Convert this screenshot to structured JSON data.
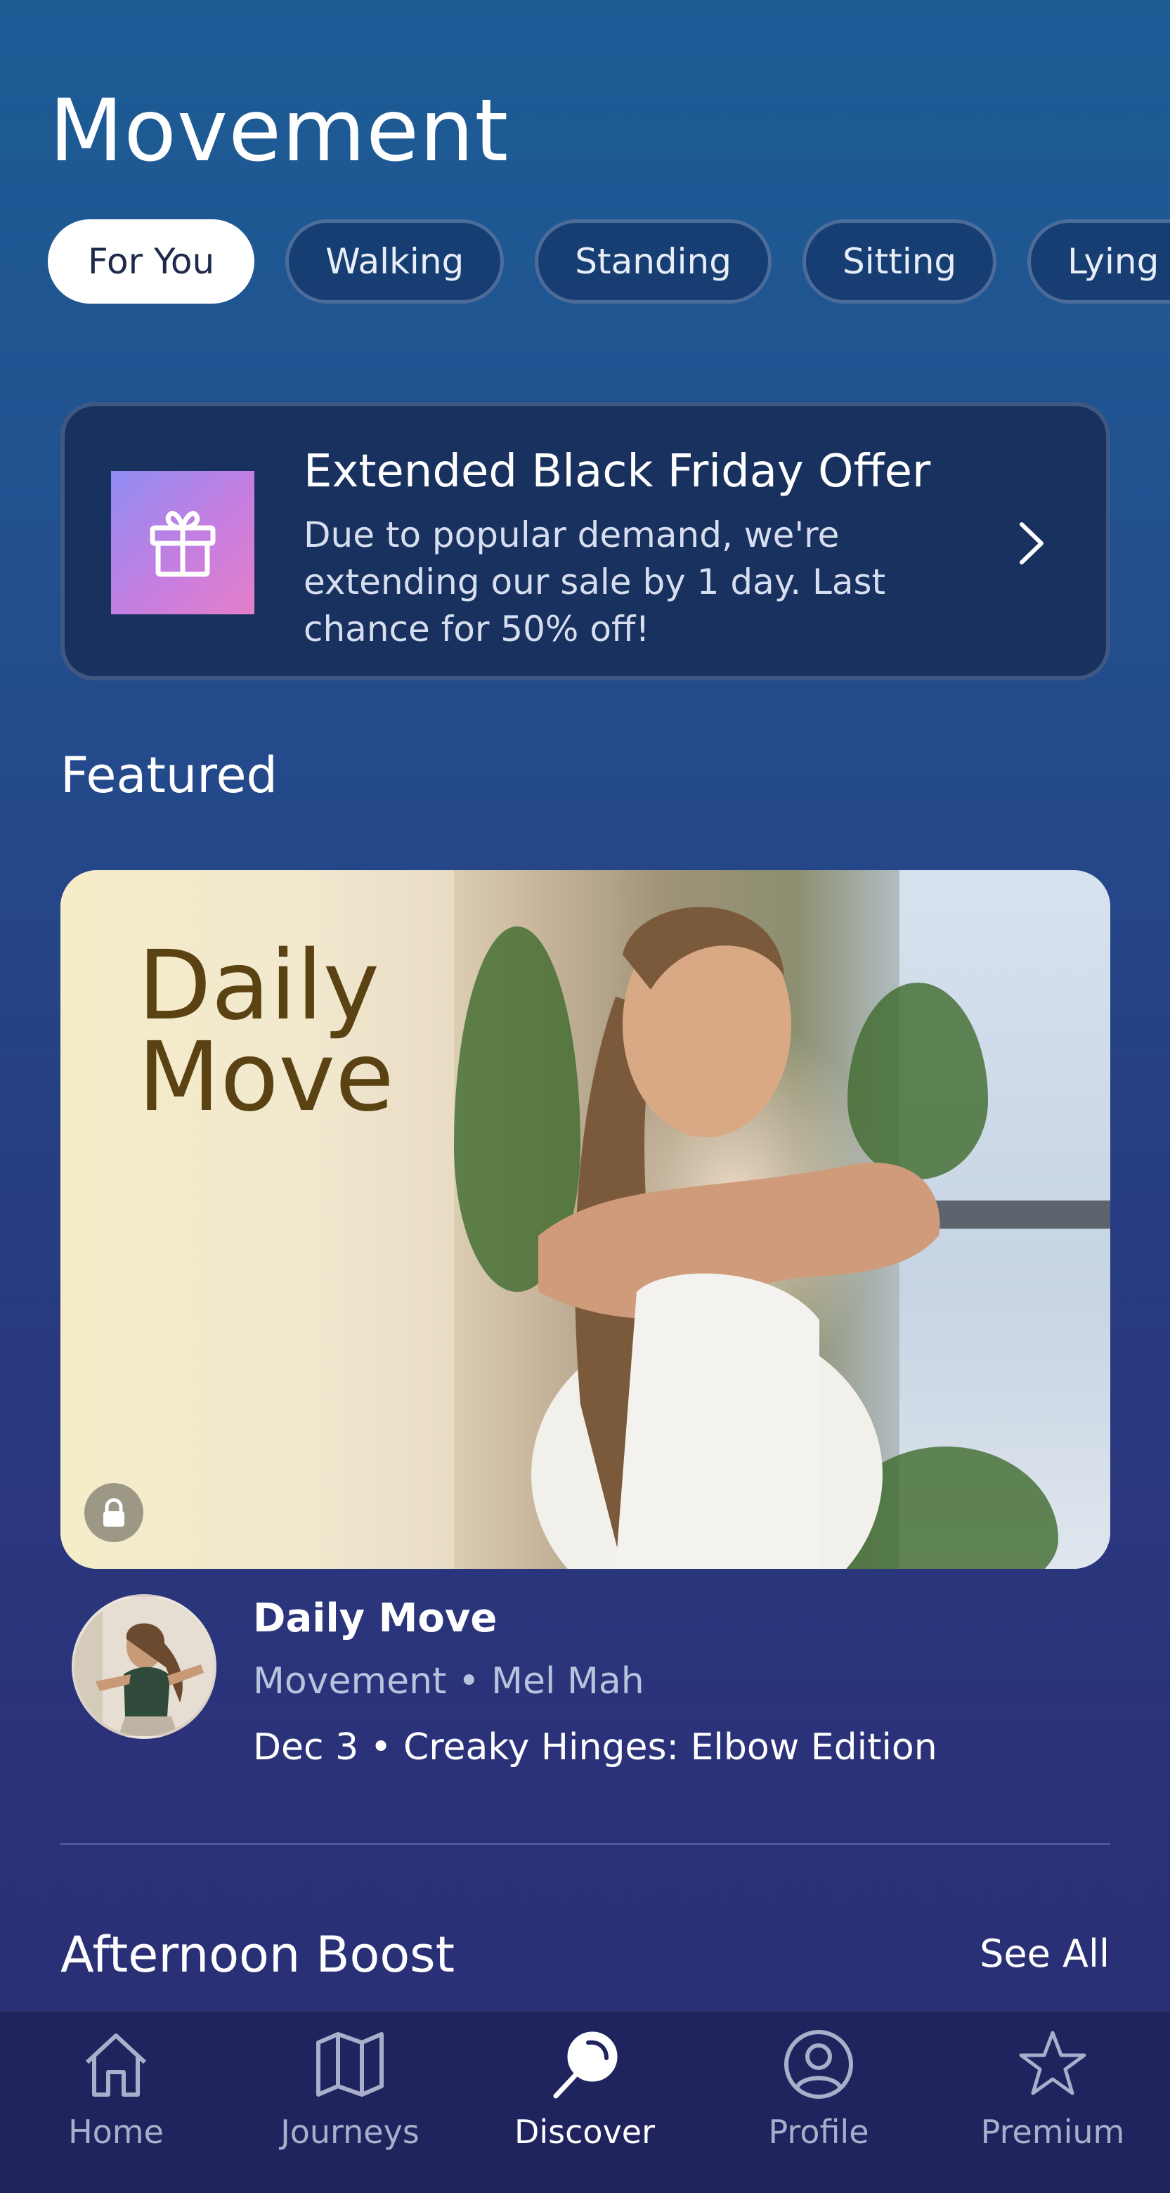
{
  "header": {
    "title": "Movement"
  },
  "filters": [
    {
      "label": "For You",
      "active": true
    },
    {
      "label": "Walking",
      "active": false
    },
    {
      "label": "Standing",
      "active": false
    },
    {
      "label": "Sitting",
      "active": false
    },
    {
      "label": "Lying D",
      "active": false
    }
  ],
  "offer": {
    "title": "Extended Black Friday Offer",
    "body": "Due to popular demand, we're extending our sale by 1 day. Last chance for 50% off!",
    "icon": "gift-icon"
  },
  "featured": {
    "section_title": "Featured",
    "card_overlay_text_line1": "Daily",
    "card_overlay_text_line2": "Move",
    "locked": true,
    "title": "Daily Move",
    "subtitle": "Movement • Mel Mah",
    "date_line": "Dec 3 • Creaky Hinges: Elbow Edition"
  },
  "afternoon": {
    "section_title": "Afternoon Boost",
    "see_all": "See All"
  },
  "tabs": [
    {
      "label": "Home",
      "icon": "home-icon",
      "active": false
    },
    {
      "label": "Journeys",
      "icon": "map-icon",
      "active": false
    },
    {
      "label": "Discover",
      "icon": "discover-icon",
      "active": true
    },
    {
      "label": "Profile",
      "icon": "profile-icon",
      "active": false
    },
    {
      "label": "Premium",
      "icon": "star-icon",
      "active": false
    }
  ],
  "colors": {
    "background_top": "#1c5d96",
    "background_bottom": "#2a2d73",
    "tabbar": "#20245e",
    "offer_card": "#19315f"
  }
}
